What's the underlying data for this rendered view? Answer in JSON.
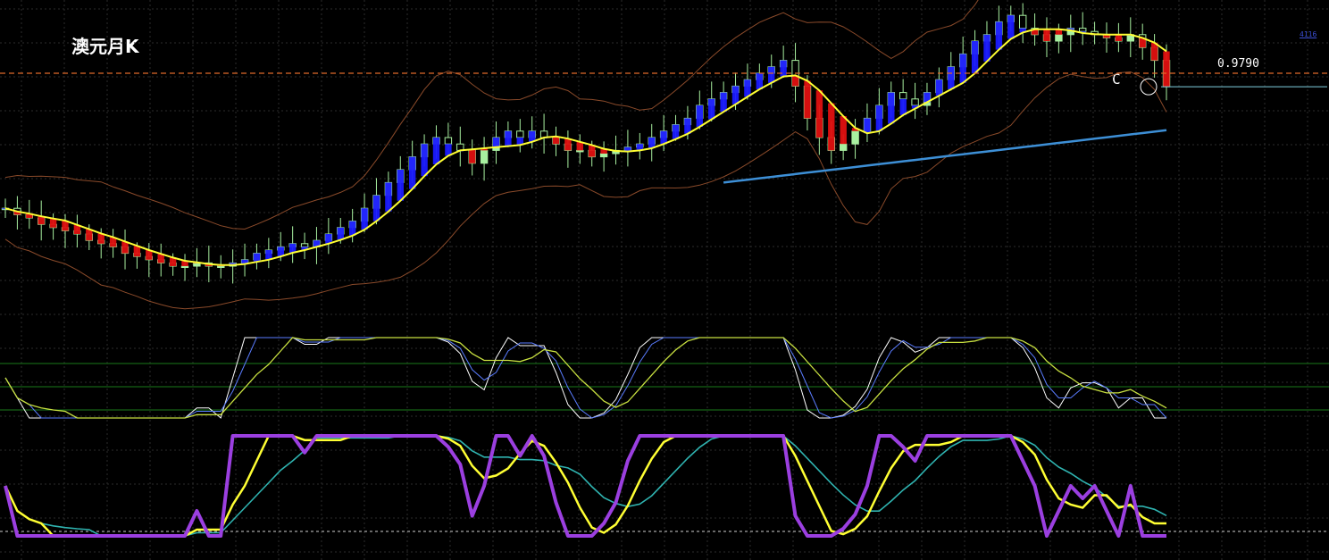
{
  "title": "澳元月K",
  "price_label": "0.9790",
  "marker_label": "C",
  "corner_tag": "4116",
  "colors": {
    "background": "#000000",
    "grid": "#2b2b2b",
    "bull": "#a8f0a0",
    "bear": "#000000",
    "band_up": "#1a1aff",
    "band_down": "#e01010",
    "ma": "#ffff33",
    "bollinger": "#8a4a2a",
    "long_ma": "#3d8fd6",
    "ref_line": "#e06a2a",
    "stoch_k": "#ffffff",
    "stoch_d": "#5a7cff",
    "stoch_slow": "#c8e040",
    "osc_fast": "#9b3fe0",
    "osc_mid": "#ffff33",
    "osc_slow": "#2fb3b0",
    "level_line": "#1a7a1a"
  },
  "chart_data": {
    "type": "candlestick",
    "symbol": "澳元月K",
    "price_range": [
      0.6,
      1.1
    ],
    "reference_level": 1.0,
    "last_price": 0.979,
    "points": [
      0.79,
      0.78,
      0.775,
      0.765,
      0.76,
      0.755,
      0.75,
      0.74,
      0.735,
      0.73,
      0.72,
      0.715,
      0.71,
      0.705,
      0.7,
      0.7,
      0.705,
      0.7,
      0.7,
      0.705,
      0.71,
      0.72,
      0.725,
      0.73,
      0.735,
      0.73,
      0.74,
      0.75,
      0.76,
      0.77,
      0.79,
      0.81,
      0.83,
      0.85,
      0.87,
      0.89,
      0.9,
      0.89,
      0.88,
      0.86,
      0.88,
      0.9,
      0.91,
      0.9,
      0.91,
      0.9,
      0.89,
      0.88,
      0.88,
      0.87,
      0.875,
      0.88,
      0.885,
      0.89,
      0.9,
      0.91,
      0.92,
      0.93,
      0.95,
      0.96,
      0.97,
      0.98,
      0.99,
      1.0,
      1.01,
      1.02,
      0.98,
      0.93,
      0.9,
      0.88,
      0.89,
      0.91,
      0.93,
      0.95,
      0.97,
      0.96,
      0.95,
      0.97,
      0.99,
      1.01,
      1.03,
      1.05,
      1.06,
      1.08,
      1.09,
      1.07,
      1.06,
      1.05,
      1.06,
      1.07,
      1.065,
      1.06,
      1.055,
      1.05,
      1.06,
      1.04,
      1.02,
      0.979
    ],
    "indicators": [
      "Bollinger Bands",
      "Moving Average",
      "Long-term MA",
      "Stochastic",
      "Oscillator"
    ]
  }
}
